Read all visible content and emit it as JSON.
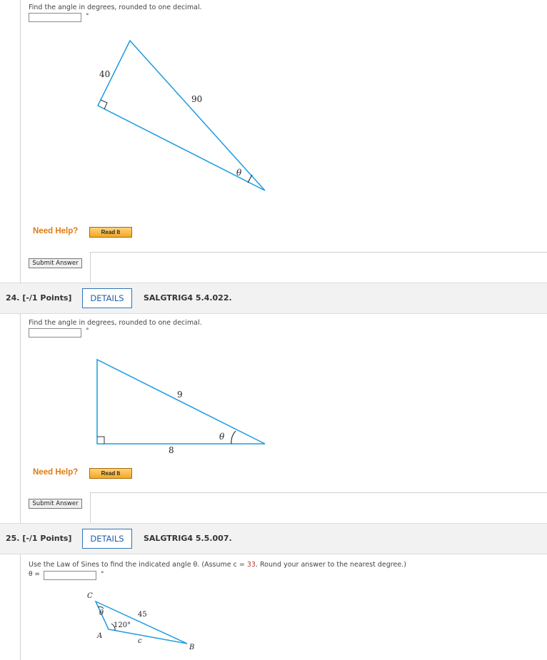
{
  "q23": {
    "prompt": "Find the angle in degrees, rounded to one decimal.",
    "degree_symbol": "°",
    "figure": {
      "side_a": "40",
      "side_b": "90",
      "angle": "θ"
    },
    "need_help": "Need Help?",
    "read_it": "Read It",
    "submit": "Submit Answer"
  },
  "q24": {
    "number": "24.  [-/1 Points]",
    "details": "DETAILS",
    "code": "SALGTRIG4 5.4.022.",
    "prompt": "Find the angle in degrees, rounded to one decimal.",
    "degree_symbol": "°",
    "figure": {
      "hyp": "9",
      "base": "8",
      "angle": "θ"
    },
    "need_help": "Need Help?",
    "read_it": "Read It",
    "submit": "Submit Answer"
  },
  "q25": {
    "number": "25.  [-/1 Points]",
    "details": "DETAILS",
    "code": "SALGTRIG4 5.5.007.",
    "prompt_pre": "Use the Law of Sines to find the indicated angle θ. (Assume c = ",
    "c_value": "33",
    "prompt_post": ". Round your answer to the nearest degree.)",
    "answer_label": "θ =",
    "degree_symbol": "°",
    "figure": {
      "vertex_c": "C",
      "vertex_a": "A",
      "vertex_b": "B",
      "side": "45",
      "angle_a": "120°",
      "side_c": "c",
      "angle": "θ"
    }
  },
  "colors": {
    "triangle": "#1e9be0",
    "help": "#e07b12",
    "details": "#1f5fa8",
    "highlight": "#c0392b"
  }
}
